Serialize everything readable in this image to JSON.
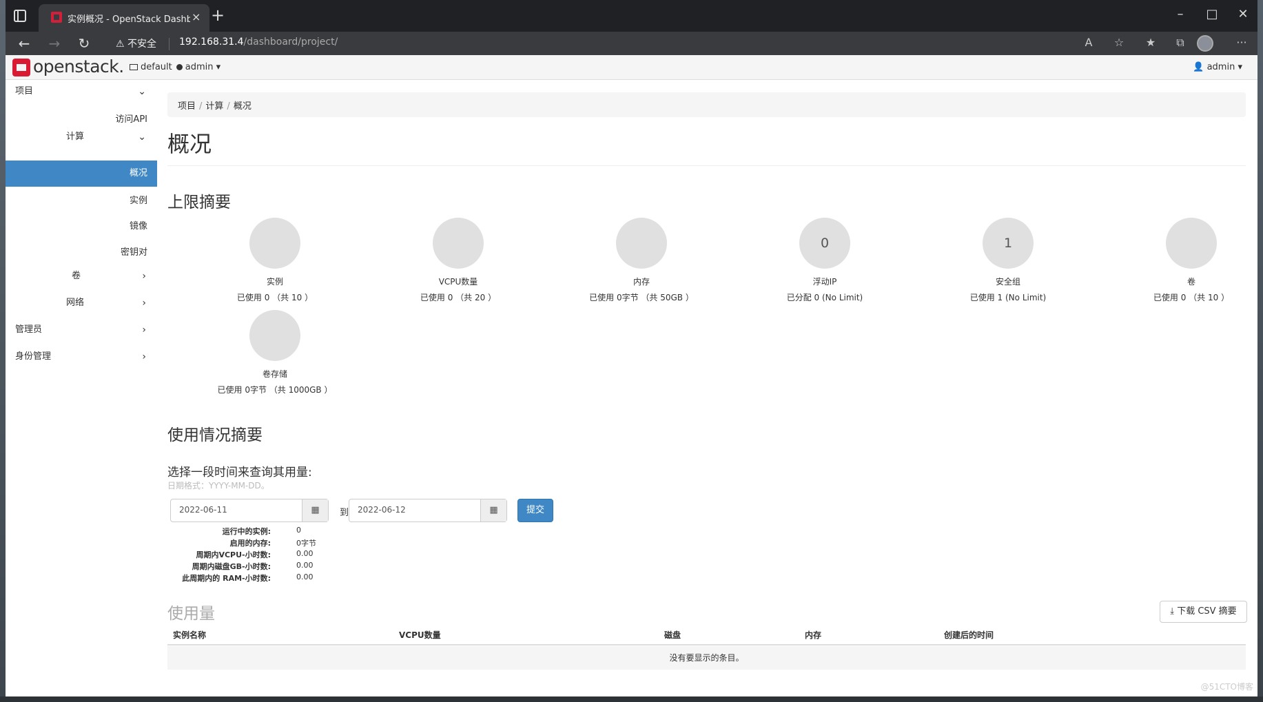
{
  "browser": {
    "tab_title": "实例概况 - OpenStack Dashboard",
    "tab_close": "×",
    "new_tab": "+",
    "security_label": "不安全",
    "url_host": "192.168.31.4",
    "url_path": "/dashboard/project/",
    "window_minimize": "–",
    "window_maximize": "□",
    "window_close": "✕",
    "more_menu": "···"
  },
  "header": {
    "logo_text": "openstack.",
    "domain": "default",
    "project": "admin",
    "caret": "▾",
    "user": "admin"
  },
  "sidebar": {
    "project": "项目",
    "access_api": "访问API",
    "compute": "计算",
    "overview": "概况",
    "instances": "实例",
    "images": "镜像",
    "keypairs": "密钥对",
    "volumes": "卷",
    "network": "网络",
    "admin": "管理员",
    "identity": "身份管理",
    "chevron_down": "⌄",
    "chevron_right": "›"
  },
  "main": {
    "breadcrumb": [
      "项目",
      "计算",
      "概况"
    ],
    "breadcrumb_sep": "/",
    "page_title": "概况",
    "limits_title": "上限摘要",
    "limits": [
      {
        "value": "",
        "name": "实例",
        "used": "已使用 0 （共 10 ）"
      },
      {
        "value": "",
        "name": "VCPU数量",
        "used": "已使用 0 （共 20 ）"
      },
      {
        "value": "",
        "name": "内存",
        "used": "已使用 0字节 （共 50GB ）"
      },
      {
        "value": "0",
        "name": "浮动IP",
        "used": "已分配 0 (No Limit)"
      },
      {
        "value": "1",
        "name": "安全组",
        "used": "已使用 1 (No Limit)"
      },
      {
        "value": "",
        "name": "卷",
        "used": "已使用 0 （共 10 ）"
      },
      {
        "value": "",
        "name": "卷存储",
        "used": "已使用 0字节 （共 1000GB ）"
      }
    ],
    "usage_summary_title": "使用情况摘要",
    "usage_question": "选择一段时间来查询其用量:",
    "date_hint": "日期格式：YYYY-MM-DD。",
    "start_date": "2022-06-11",
    "to_label": "到",
    "end_date": "2022-06-12",
    "submit": "提交",
    "calendar_icon": "▦",
    "stats": [
      {
        "label": "运行中的实例:",
        "value": "0"
      },
      {
        "label": "启用的内存:",
        "value": "0字节"
      },
      {
        "label": "周期内VCPU-小时数:",
        "value": "0.00"
      },
      {
        "label": "周期内磁盘GB-小时数:",
        "value": "0.00"
      },
      {
        "label": "此周期内的 RAM-小时数:",
        "value": "0.00"
      }
    ],
    "usage_title": "使用量",
    "csv_button": "下载 CSV 摘要",
    "table_headers": [
      "实例名称",
      "VCPU数量",
      "磁盘",
      "内存",
      "创建后的时间"
    ],
    "empty_text": "没有要显示的条目。"
  },
  "watermark": "@51CTO博客"
}
